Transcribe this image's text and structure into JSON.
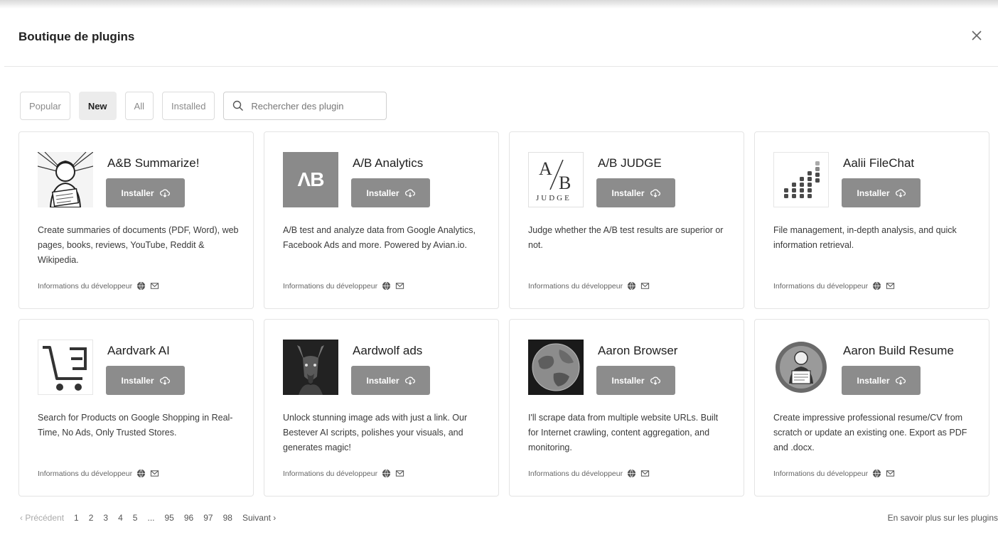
{
  "dialog": {
    "title": "Boutique de plugins"
  },
  "filters": {
    "tabs": [
      {
        "label": "Popular"
      },
      {
        "label": "New",
        "active": true
      },
      {
        "label": "All"
      },
      {
        "label": "Installed"
      }
    ],
    "search_placeholder": "Rechercher des plugin"
  },
  "install_label": "Installer",
  "dev_info_label": "Informations du développeur",
  "plugins": [
    {
      "name": "A&B Summarize!",
      "logo": "vintage-woman-reading-icon",
      "description": "Create summaries of documents (PDF, Word), web pages, books, reviews, YouTube, Reddit & Wikipedia."
    },
    {
      "name": "A/B Analytics",
      "logo": "ab-monogram-icon",
      "logo_text": "ΛB",
      "description": "A/B test and analyze data from Google Analytics, Facebook Ads and more. Powered by Avian.io."
    },
    {
      "name": "A/B JUDGE",
      "logo": "ab-judge-icon",
      "logo_text_top": "A",
      "logo_text_bottom": "B",
      "logo_text_word": "JUDGE",
      "description": "Judge whether the A/B test results are superior or not."
    },
    {
      "name": "Aalii FileChat",
      "logo": "dot-bars-icon",
      "description": "File management, in-depth analysis, and quick information retrieval."
    },
    {
      "name": "Aardvark AI",
      "logo": "shopping-cart-icon",
      "description": "Search for Products on Google Shopping in Real-Time, No Ads, Only Trusted Stores."
    },
    {
      "name": "Aardwolf ads",
      "logo": "aardwolf-photo-icon",
      "description": "Unlock stunning image ads with just a link. Our Bestever AI scripts, polishes your visuals, and generates magic!"
    },
    {
      "name": "Aaron Browser",
      "logo": "globe-icon",
      "description": "I'll scrape data from multiple website URLs. Built for Internet crawling, content aggregation, and monitoring."
    },
    {
      "name": "Aaron Build Resume",
      "logo": "resume-avatar-icon",
      "description": "Create impressive professional resume/CV from scratch or update an existing one. Export as PDF and .docx."
    }
  ],
  "pagination": {
    "prev": "‹ Précédent",
    "pages": [
      "1",
      "2",
      "3",
      "4",
      "5",
      "...",
      "95",
      "96",
      "97",
      "98"
    ],
    "next": "Suivant ›"
  },
  "learn_more": "En savoir plus sur les plugins"
}
